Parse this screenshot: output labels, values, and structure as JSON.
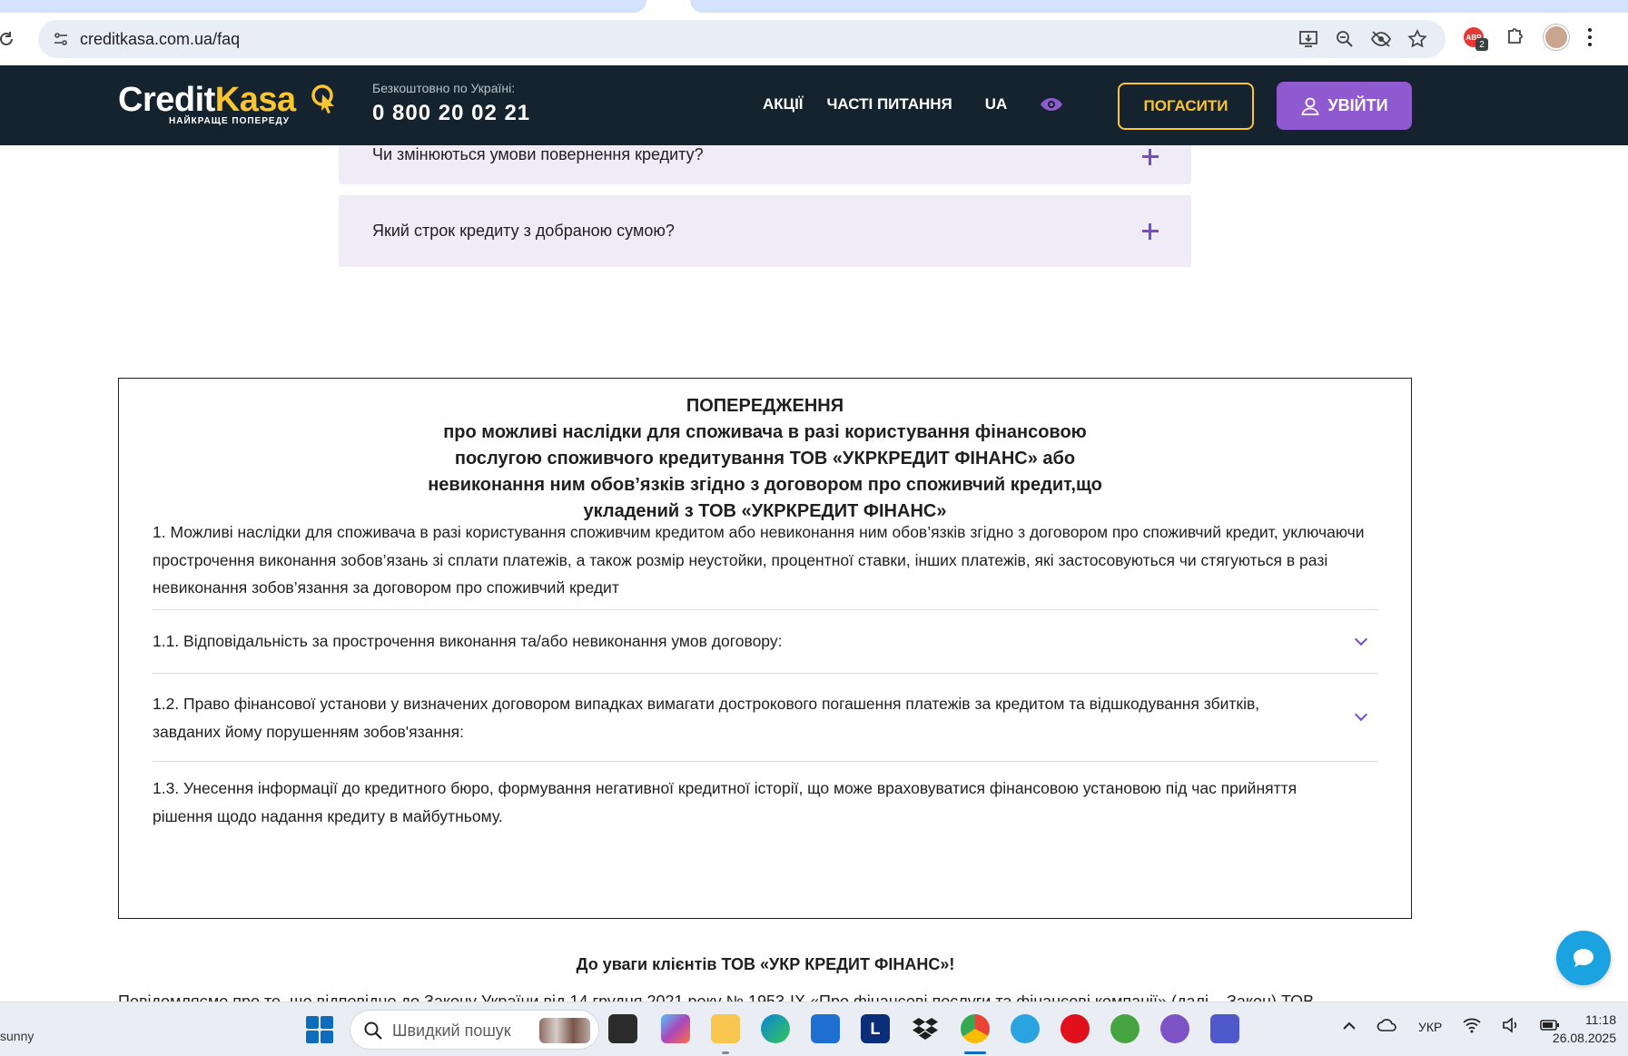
{
  "browser": {
    "url": "creditkasa.com.ua/faq",
    "extension_badge_label": "ABP",
    "extension_badge_count": "2"
  },
  "header": {
    "logo_part1": "Credit",
    "logo_part2": "Kasa",
    "logo_tagline": "НАЙКРАЩЕ ПОПЕРЕДУ",
    "hotline_label": "Безкоштовно по Україні:",
    "hotline_phone": "0 800 20 02 21",
    "nav": [
      "АКЦІЇ",
      "ЧАСТІ ПИТАННЯ",
      "UA"
    ],
    "pay_button": "ПОГАСИТИ",
    "login_button": "УВІЙТИ",
    "colors": {
      "header_bg": "#14232d",
      "accent_yellow": "#fbc531",
      "accent_purple": "#8f5ad0"
    }
  },
  "faq": {
    "items": [
      "Чи змінюються умови повернення кредиту?",
      "Який строк кредиту з добраною сумою?"
    ]
  },
  "warning": {
    "title_lines": [
      "ПОПЕРЕДЖЕННЯ",
      "про можливі наслідки для споживача в разі користування фінансовою",
      "послугою споживчого кредитування ТОВ «УКРКРЕДИТ ФІНАНС» або",
      "невиконання ним обов’язків згідно з договором про споживчий кредит,що",
      "укладений з ТОВ «УКРКРЕДИТ ФІНАНС»"
    ],
    "intro": "1. Можливі наслідки для споживача в разі користування споживчим кредитом або невиконання ним обов’язків згідно з договором про споживчий кредит, уключаючи прострочення виконання зобов’язань зі сплати платежів, а також розмір неустойки, процентної ставки, інших платежів, які застосовуються чи стягуються в разі невиконання зобов’язання за договором про споживчий кредит",
    "items": [
      "1.1. Відповідальність за прострочення виконання та/або невиконання умов договору:",
      "1.2. Право фінансової установи у визначених договором випадках вимагати дострокового погашення платежів за кредитом та відшкодування збитків, завданих йому порушенням зобов'язання:",
      "1.3. Унесення інформації до кредитного бюро, формування негативної кредитної історії, що може враховуватися фінансовою установою під час прийняття рішення щодо надання кредиту в майбутньому."
    ]
  },
  "notice": {
    "title": "До уваги клієнтів ТОВ «УКР КРЕДИТ ФІНАНС»!",
    "partial_text": "Повідомляємо про те, що відповідно до Закону України від 14 грудня 2021 року № 1953-IX «Про фінансові послуги та фінансові компанії» (далі – Закон) ТОВ"
  },
  "taskbar": {
    "weather": "sunny",
    "search_placeholder": "Швидкий пошук",
    "language": "УКР",
    "time": "11:18",
    "date": "26.08.2025"
  }
}
